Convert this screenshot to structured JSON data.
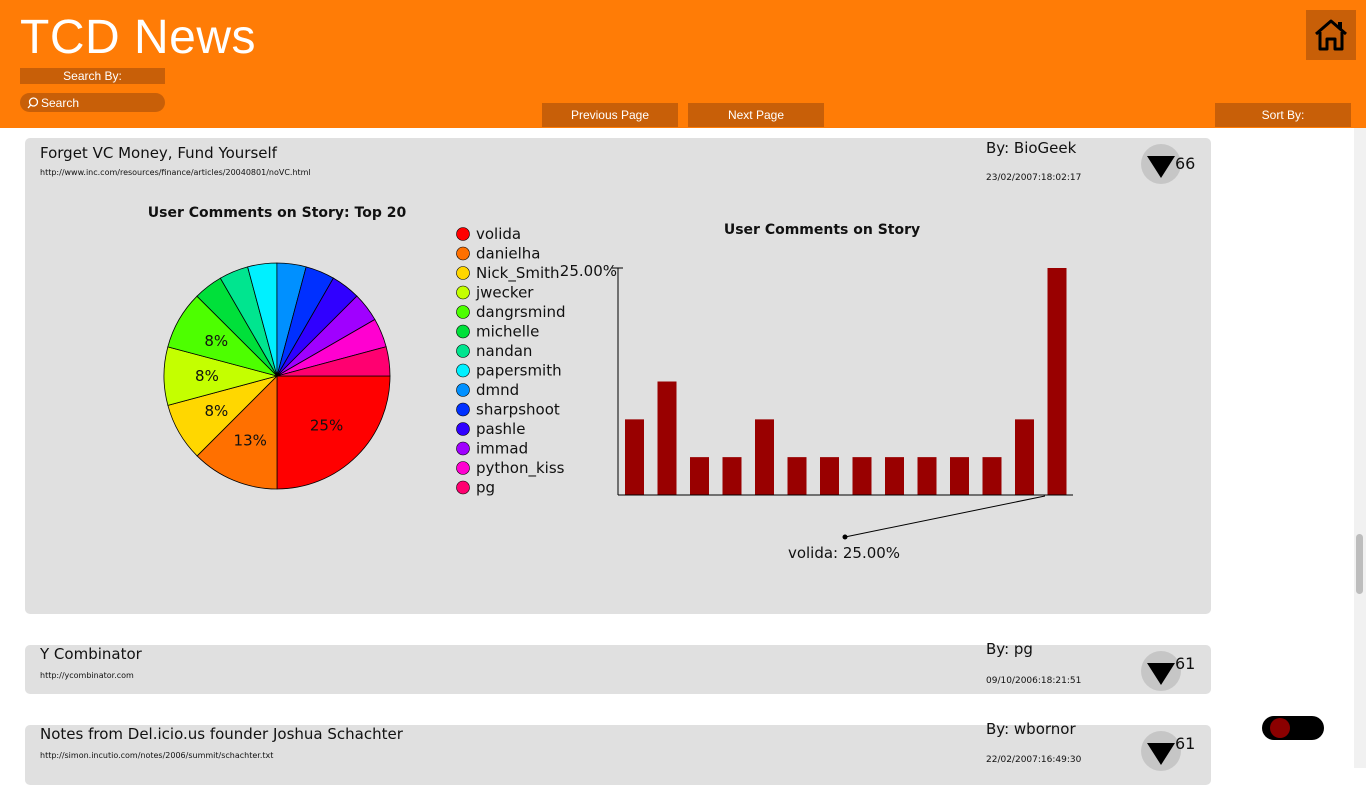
{
  "header": {
    "title": "TCD News",
    "search_by_label": "Search By:",
    "search_placeholder": "Search",
    "prev_page_label": "Previous Page",
    "next_page_label": "Next Page",
    "sort_by_label": "Sort By:",
    "home_icon": "home-icon"
  },
  "stories": [
    {
      "title": "Forget VC Money, Fund Yourself",
      "url": "http://www.inc.com/resources/finance/articles/20040801/noVC.html",
      "author": "By: BioGeek",
      "date": "23/02/2007:18:02:17",
      "votes": "66"
    },
    {
      "title": "Y Combinator",
      "url": "http://ycombinator.com",
      "author": "By: pg",
      "date": "09/10/2006:18:21:51",
      "votes": "61"
    },
    {
      "title": "Notes from Del.icio.us founder Joshua Schachter",
      "url": "http://simon.incutio.com/notes/2006/summit/schachter.txt",
      "author": "By: wbornor",
      "date": "22/02/2007:16:49:30",
      "votes": "61"
    }
  ],
  "colors": {
    "header_bg": "#ff7c06",
    "button_bg": "#c85f08",
    "card_bg": "#e0e0e0",
    "bar_color": "#990000"
  },
  "chart_data": [
    {
      "type": "pie",
      "title": "User Comments on Story: Top 20",
      "labels": [
        "volida",
        "danielha",
        "Nick_Smith",
        "jwecker",
        "dangrsmind",
        "michelle",
        "nandan",
        "papersmith",
        "dmnd",
        "sharpshoot",
        "pashle",
        "immad",
        "python_kiss",
        "pg"
      ],
      "values": [
        25,
        12.5,
        8.33,
        8.33,
        8.33,
        4.17,
        4.17,
        4.17,
        4.17,
        4.17,
        4.17,
        4.17,
        4.17,
        4.17
      ],
      "slice_labels": [
        "25%",
        "13%",
        "8%",
        "8%",
        "8%",
        "",
        "",
        "",
        "",
        "",
        "",
        "",
        "",
        ""
      ],
      "colors": [
        "#ff0000",
        "#ff7000",
        "#ffd700",
        "#c4ff00",
        "#4dff00",
        "#00e03a",
        "#00e58f",
        "#00f0ff",
        "#0090ff",
        "#0030ff",
        "#3000ff",
        "#a000ff",
        "#ff00d0",
        "#ff0070"
      ],
      "legend_position": "right"
    },
    {
      "type": "bar",
      "title": "User Comments on Story",
      "ylabel_tick": "25.00%",
      "values": [
        8.33,
        12.5,
        4.17,
        4.17,
        8.33,
        4.17,
        4.17,
        4.17,
        4.17,
        4.17,
        4.17,
        4.17,
        8.33,
        25
      ],
      "ylim": [
        0,
        25
      ],
      "annotation": "volida: 25.00%"
    }
  ]
}
